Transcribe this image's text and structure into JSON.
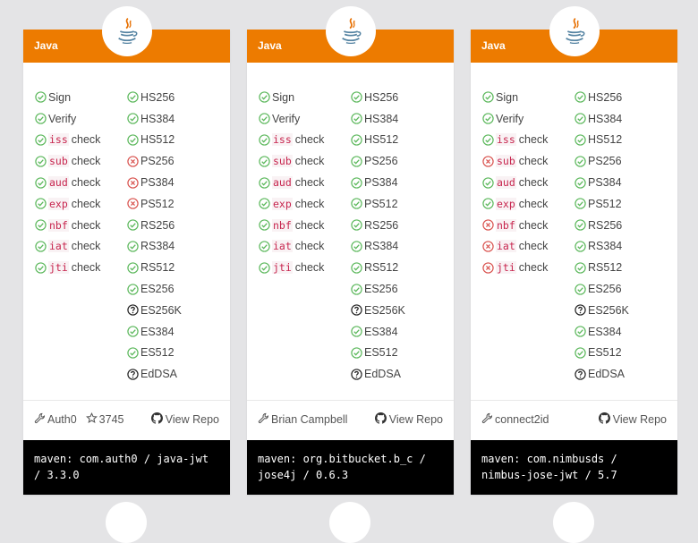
{
  "icons": {
    "pass": "check-circle-icon",
    "fail": "x-circle-icon",
    "unknown": "question-circle-icon",
    "author": "wrench-icon",
    "stars": "star-icon",
    "repo": "github-icon",
    "logo": "java-coffee-cup-icon"
  },
  "colors": {
    "header": "#ed7b00",
    "pass": "#5cb85c",
    "fail": "#d9534f",
    "code_text": "#c7254e",
    "install_bg": "#000000"
  },
  "cards": [
    {
      "language": "Java",
      "checks": [
        {
          "label": "Sign",
          "status": "pass"
        },
        {
          "label": "Verify",
          "status": "pass"
        },
        {
          "code": "iss",
          "label": "check",
          "status": "pass"
        },
        {
          "code": "sub",
          "label": "check",
          "status": "pass"
        },
        {
          "code": "aud",
          "label": "check",
          "status": "pass"
        },
        {
          "code": "exp",
          "label": "check",
          "status": "pass"
        },
        {
          "code": "nbf",
          "label": "check",
          "status": "pass"
        },
        {
          "code": "iat",
          "label": "check",
          "status": "pass"
        },
        {
          "code": "jti",
          "label": "check",
          "status": "pass"
        }
      ],
      "algorithms": [
        {
          "label": "HS256",
          "status": "pass"
        },
        {
          "label": "HS384",
          "status": "pass"
        },
        {
          "label": "HS512",
          "status": "pass"
        },
        {
          "label": "PS256",
          "status": "fail"
        },
        {
          "label": "PS384",
          "status": "fail"
        },
        {
          "label": "PS512",
          "status": "fail"
        },
        {
          "label": "RS256",
          "status": "pass"
        },
        {
          "label": "RS384",
          "status": "pass"
        },
        {
          "label": "RS512",
          "status": "pass"
        },
        {
          "label": "ES256",
          "status": "pass"
        },
        {
          "label": "ES256K",
          "status": "unknown"
        },
        {
          "label": "ES384",
          "status": "pass"
        },
        {
          "label": "ES512",
          "status": "pass"
        },
        {
          "label": "EdDSA",
          "status": "unknown"
        }
      ],
      "author": "Auth0",
      "stars": "3745",
      "view_repo": "View Repo",
      "install": "maven: com.auth0 / java-jwt / 3.3.0"
    },
    {
      "language": "Java",
      "checks": [
        {
          "label": "Sign",
          "status": "pass"
        },
        {
          "label": "Verify",
          "status": "pass"
        },
        {
          "code": "iss",
          "label": "check",
          "status": "pass"
        },
        {
          "code": "sub",
          "label": "check",
          "status": "pass"
        },
        {
          "code": "aud",
          "label": "check",
          "status": "pass"
        },
        {
          "code": "exp",
          "label": "check",
          "status": "pass"
        },
        {
          "code": "nbf",
          "label": "check",
          "status": "pass"
        },
        {
          "code": "iat",
          "label": "check",
          "status": "pass"
        },
        {
          "code": "jti",
          "label": "check",
          "status": "pass"
        }
      ],
      "algorithms": [
        {
          "label": "HS256",
          "status": "pass"
        },
        {
          "label": "HS384",
          "status": "pass"
        },
        {
          "label": "HS512",
          "status": "pass"
        },
        {
          "label": "PS256",
          "status": "pass"
        },
        {
          "label": "PS384",
          "status": "pass"
        },
        {
          "label": "PS512",
          "status": "pass"
        },
        {
          "label": "RS256",
          "status": "pass"
        },
        {
          "label": "RS384",
          "status": "pass"
        },
        {
          "label": "RS512",
          "status": "pass"
        },
        {
          "label": "ES256",
          "status": "pass"
        },
        {
          "label": "ES256K",
          "status": "unknown"
        },
        {
          "label": "ES384",
          "status": "pass"
        },
        {
          "label": "ES512",
          "status": "pass"
        },
        {
          "label": "EdDSA",
          "status": "unknown"
        }
      ],
      "author": "Brian Campbell",
      "stars": "",
      "view_repo": "View Repo",
      "install": "maven: org.bitbucket.b_c / jose4j / 0.6.3"
    },
    {
      "language": "Java",
      "checks": [
        {
          "label": "Sign",
          "status": "pass"
        },
        {
          "label": "Verify",
          "status": "pass"
        },
        {
          "code": "iss",
          "label": "check",
          "status": "pass"
        },
        {
          "code": "sub",
          "label": "check",
          "status": "fail"
        },
        {
          "code": "aud",
          "label": "check",
          "status": "pass"
        },
        {
          "code": "exp",
          "label": "check",
          "status": "pass"
        },
        {
          "code": "nbf",
          "label": "check",
          "status": "fail"
        },
        {
          "code": "iat",
          "label": "check",
          "status": "fail"
        },
        {
          "code": "jti",
          "label": "check",
          "status": "fail"
        }
      ],
      "algorithms": [
        {
          "label": "HS256",
          "status": "pass"
        },
        {
          "label": "HS384",
          "status": "pass"
        },
        {
          "label": "HS512",
          "status": "pass"
        },
        {
          "label": "PS256",
          "status": "pass"
        },
        {
          "label": "PS384",
          "status": "pass"
        },
        {
          "label": "PS512",
          "status": "pass"
        },
        {
          "label": "RS256",
          "status": "pass"
        },
        {
          "label": "RS384",
          "status": "pass"
        },
        {
          "label": "RS512",
          "status": "pass"
        },
        {
          "label": "ES256",
          "status": "pass"
        },
        {
          "label": "ES256K",
          "status": "unknown"
        },
        {
          "label": "ES384",
          "status": "pass"
        },
        {
          "label": "ES512",
          "status": "pass"
        },
        {
          "label": "EdDSA",
          "status": "unknown"
        }
      ],
      "author": "connect2id",
      "stars": "",
      "view_repo": "View Repo",
      "install": "maven: com.nimbusds / nimbus-jose-jwt / 5.7"
    }
  ]
}
